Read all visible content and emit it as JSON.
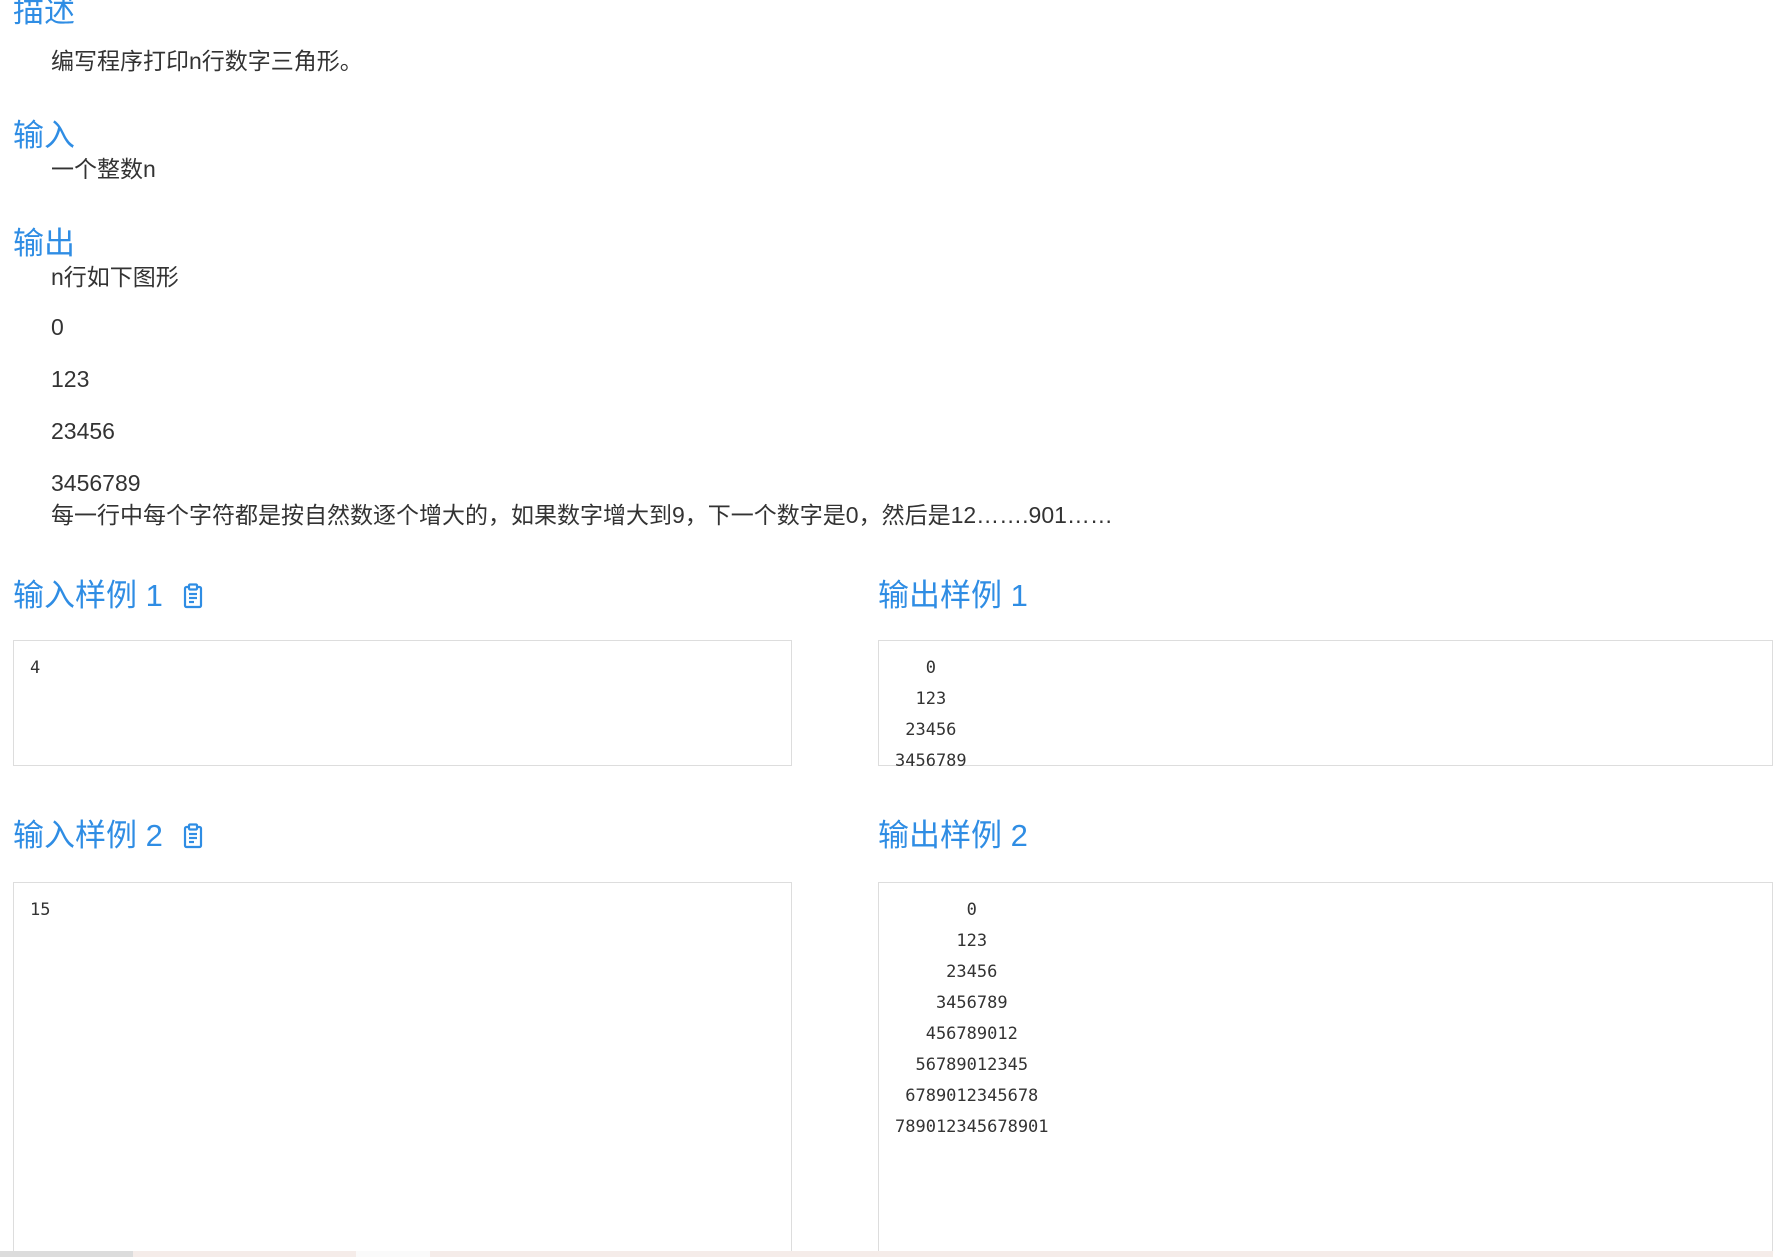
{
  "description": {
    "heading": "描述",
    "text": "编写程序打印n行数字三角形。"
  },
  "input": {
    "heading": "输入",
    "text": "一个整数n"
  },
  "output": {
    "heading": "输出",
    "text": "n行如下图形",
    "figure_lines": [
      "0",
      "123",
      "23456",
      "3456789"
    ],
    "note": "每一行中每个字符都是按自然数逐个增大的，如果数字增大到9，下一个数字是0，然后是12…….901……"
  },
  "samples": {
    "input_1": {
      "title": "输入样例 1",
      "content": "4"
    },
    "output_1": {
      "title": "输出样例 1",
      "lines": [
        "0",
        "123",
        "23456",
        "3456789"
      ]
    },
    "input_2": {
      "title": "输入样例 2",
      "content": "15"
    },
    "output_2": {
      "title": "输出样例 2",
      "lines": [
        "0",
        "123",
        "23456",
        "3456789",
        "456789012",
        "56789012345",
        "6789012345678",
        "789012345678901"
      ]
    }
  },
  "icons": {
    "copy": "clipboard-icon"
  },
  "colors": {
    "heading": "#2f8de4",
    "text": "#333333",
    "border": "#dddddd"
  }
}
